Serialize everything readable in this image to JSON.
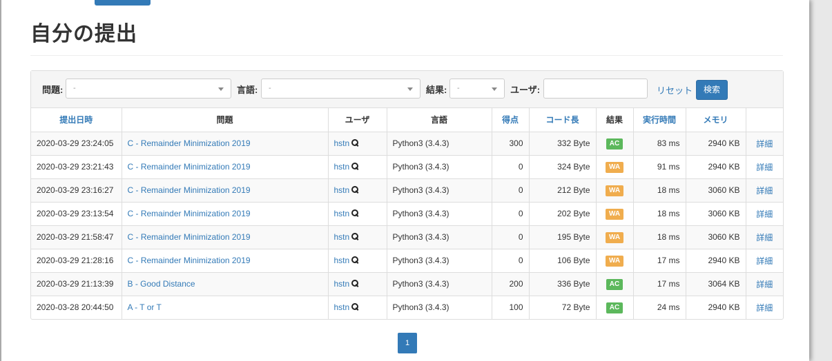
{
  "page": {
    "title": "自分の提出"
  },
  "filters": {
    "problem_label": "問題:",
    "problem_value": "-",
    "language_label": "言語:",
    "language_value": "-",
    "result_label": "結果:",
    "result_value": "-",
    "user_label": "ユーザ:",
    "user_value": "",
    "reset_label": "リセット",
    "search_label": "検索"
  },
  "table": {
    "headers": [
      "提出日時",
      "問題",
      "ユーザ",
      "言語",
      "得点",
      "コード長",
      "結果",
      "実行時間",
      "メモリ",
      ""
    ],
    "rows": [
      {
        "date": "2020-03-29 23:24:05",
        "problem": "C - Remainder Minimization 2019",
        "user": "hstn",
        "language": "Python3 (3.4.3)",
        "score": "300",
        "code_length": "332 Byte",
        "result": "AC",
        "time": "83 ms",
        "memory": "2940 KB",
        "detail": "詳細"
      },
      {
        "date": "2020-03-29 23:21:43",
        "problem": "C - Remainder Minimization 2019",
        "user": "hstn",
        "language": "Python3 (3.4.3)",
        "score": "0",
        "code_length": "324 Byte",
        "result": "WA",
        "time": "91 ms",
        "memory": "2940 KB",
        "detail": "詳細"
      },
      {
        "date": "2020-03-29 23:16:27",
        "problem": "C - Remainder Minimization 2019",
        "user": "hstn",
        "language": "Python3 (3.4.3)",
        "score": "0",
        "code_length": "212 Byte",
        "result": "WA",
        "time": "18 ms",
        "memory": "3060 KB",
        "detail": "詳細"
      },
      {
        "date": "2020-03-29 23:13:54",
        "problem": "C - Remainder Minimization 2019",
        "user": "hstn",
        "language": "Python3 (3.4.3)",
        "score": "0",
        "code_length": "202 Byte",
        "result": "WA",
        "time": "18 ms",
        "memory": "3060 KB",
        "detail": "詳細"
      },
      {
        "date": "2020-03-29 21:58:47",
        "problem": "C - Remainder Minimization 2019",
        "user": "hstn",
        "language": "Python3 (3.4.3)",
        "score": "0",
        "code_length": "195 Byte",
        "result": "WA",
        "time": "18 ms",
        "memory": "3060 KB",
        "detail": "詳細"
      },
      {
        "date": "2020-03-29 21:28:16",
        "problem": "C - Remainder Minimization 2019",
        "user": "hstn",
        "language": "Python3 (3.4.3)",
        "score": "0",
        "code_length": "106 Byte",
        "result": "WA",
        "time": "17 ms",
        "memory": "2940 KB",
        "detail": "詳細"
      },
      {
        "date": "2020-03-29 21:13:39",
        "problem": "B - Good Distance",
        "user": "hstn",
        "language": "Python3 (3.4.3)",
        "score": "200",
        "code_length": "336 Byte",
        "result": "AC",
        "time": "17 ms",
        "memory": "3064 KB",
        "detail": "詳細"
      },
      {
        "date": "2020-03-28 20:44:50",
        "problem": "A - T or T",
        "user": "hstn",
        "language": "Python3 (3.4.3)",
        "score": "100",
        "code_length": "72 Byte",
        "result": "AC",
        "time": "24 ms",
        "memory": "2940 KB",
        "detail": "詳細"
      }
    ]
  },
  "pagination": {
    "current": "1"
  },
  "colors": {
    "link": "#337ab7",
    "ac": "#5cb85c",
    "wa": "#f0ad4e"
  }
}
